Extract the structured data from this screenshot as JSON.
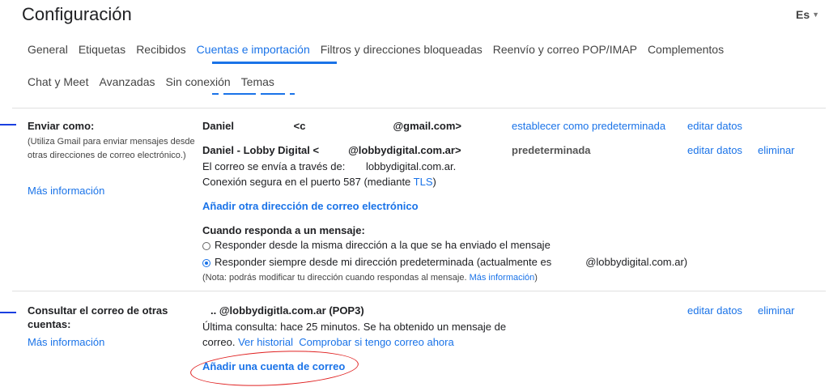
{
  "title": "Configuración",
  "lang": "Es",
  "tabs_row1": [
    "General",
    "Etiquetas",
    "Recibidos",
    "Cuentas e importación",
    "Filtros y direcciones bloqueadas",
    "Reenvío y correo POP/IMAP",
    "Complementos"
  ],
  "tabs_row2": [
    "Chat y Meet",
    "Avanzadas",
    "Sin conexión",
    "Temas"
  ],
  "active_tab": "Cuentas e importación",
  "send_as": {
    "title": "Enviar como:",
    "desc": "(Utiliza Gmail para enviar mensajes desde otras direcciones de correo electrónico.)",
    "more_info": "Más información",
    "account1": {
      "name": "Daniel ",
      "email_prefix": "<c",
      "email_suffix": "@gmail.com>",
      "set_default": "establecer como predeterminada",
      "edit": "editar datos"
    },
    "account2": {
      "name": "Daniel - Lobby Digital <",
      "email_suffix": "@lobbydigital.com.ar>",
      "default_label": "predeterminada",
      "edit": "editar datos",
      "delete": "eliminar"
    },
    "sent_via_prefix": "El correo se envía a través de: ",
    "sent_via_suffix": "lobbydigital.com.ar.",
    "secure_conn": "Conexión segura en el puerto 587 (mediante ",
    "tls": "TLS",
    "secure_conn_end": ")",
    "add_address": "Añadir otra dirección de correo electrónico",
    "reply_heading": "Cuando responda a un mensaje:",
    "reply_opt1": "Responder desde la misma dirección a la que se ha enviado el mensaje",
    "reply_opt2_prefix": "Responder siempre desde mi dirección predeterminada (actualmente es",
    "reply_opt2_suffix": "@lobbydigital.com.ar)",
    "note_prefix": "(Nota: podrás modificar tu dirección cuando respondas al mensaje. ",
    "note_link": "Más información",
    "note_suffix": ")"
  },
  "check_mail": {
    "title_line1": "Consultar el correo de otras",
    "title_line2": "cuentas:",
    "more_info": "Más información",
    "account_prefix": ".. ",
    "account_email": "@lobbydigitla.com.ar (POP3)",
    "edit": "editar datos",
    "delete": "eliminar",
    "last_check_line1": "Última consulta: hace 25 minutos. Se ha obtenido un mensaje de",
    "last_check_line2": "correo. ",
    "view_history": "Ver historial",
    "check_now": "Comprobar si tengo correo ahora",
    "add_account": "Añadir una cuenta de correo"
  }
}
